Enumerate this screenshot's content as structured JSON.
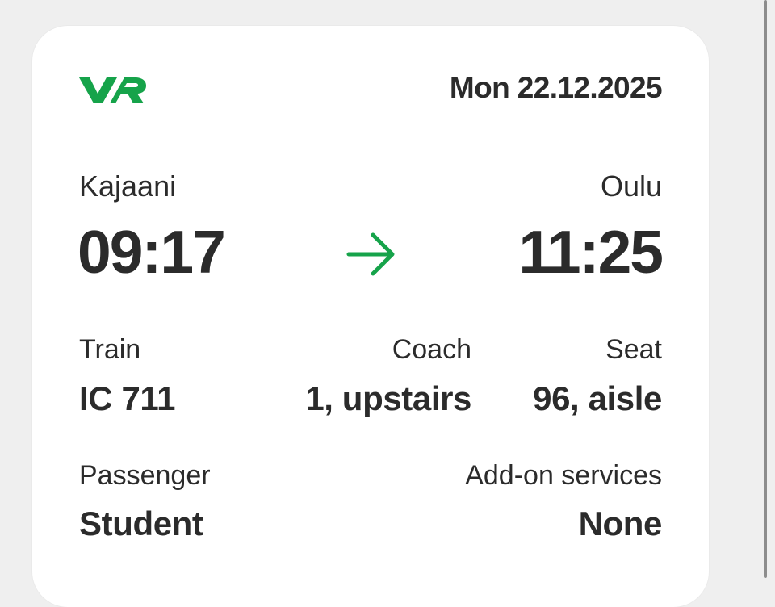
{
  "ticket": {
    "logo_text": "VR",
    "date": "Mon 22.12.2025",
    "from_station": "Kajaani",
    "to_station": "Oulu",
    "departure_time": "09:17",
    "arrival_time": "11:25",
    "train_label": "Train",
    "train_value": "IC 711",
    "coach_label": "Coach",
    "coach_value": "1, upstairs",
    "seat_label": "Seat",
    "seat_value": "96, aisle",
    "passenger_label": "Passenger",
    "passenger_value": "Student",
    "addon_label": "Add-on services",
    "addon_value": "None"
  },
  "colors": {
    "brand_green": "#16a34a",
    "text_primary": "#2b2b2b",
    "card_background": "#ffffff",
    "page_background": "#efefef"
  },
  "icons": {
    "logo": "vr-logo",
    "direction": "arrow-right-icon"
  }
}
